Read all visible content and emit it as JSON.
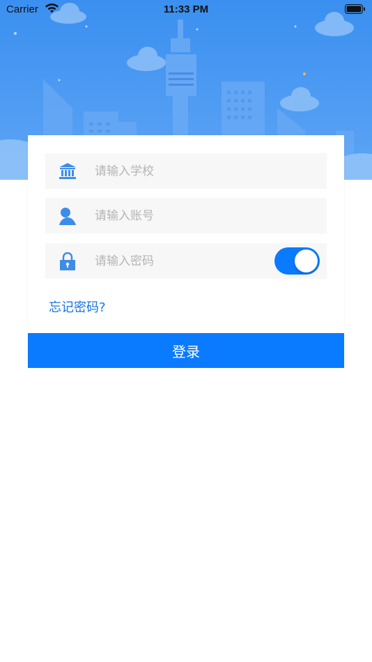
{
  "status_bar": {
    "carrier": "Carrier",
    "time": "11:33 PM"
  },
  "form": {
    "school_placeholder": "请输入学校",
    "account_placeholder": "请输入账号",
    "password_placeholder": "请输入密码",
    "password_visible_toggle_on": true,
    "forgot_password_label": "忘记密码?",
    "login_label": "登录"
  },
  "colors": {
    "accent": "#0a7aff",
    "link": "#1473e6",
    "hero_top": "#3a8ff0",
    "hero_bottom": "#6fb0f7",
    "field_bg": "#f7f7f7",
    "icon_blue": "#3d8de8"
  },
  "icons": {
    "school": "bank-building-icon",
    "account": "person-icon",
    "password": "padlock-icon",
    "wifi": "wifi-icon",
    "battery": "battery-icon"
  }
}
